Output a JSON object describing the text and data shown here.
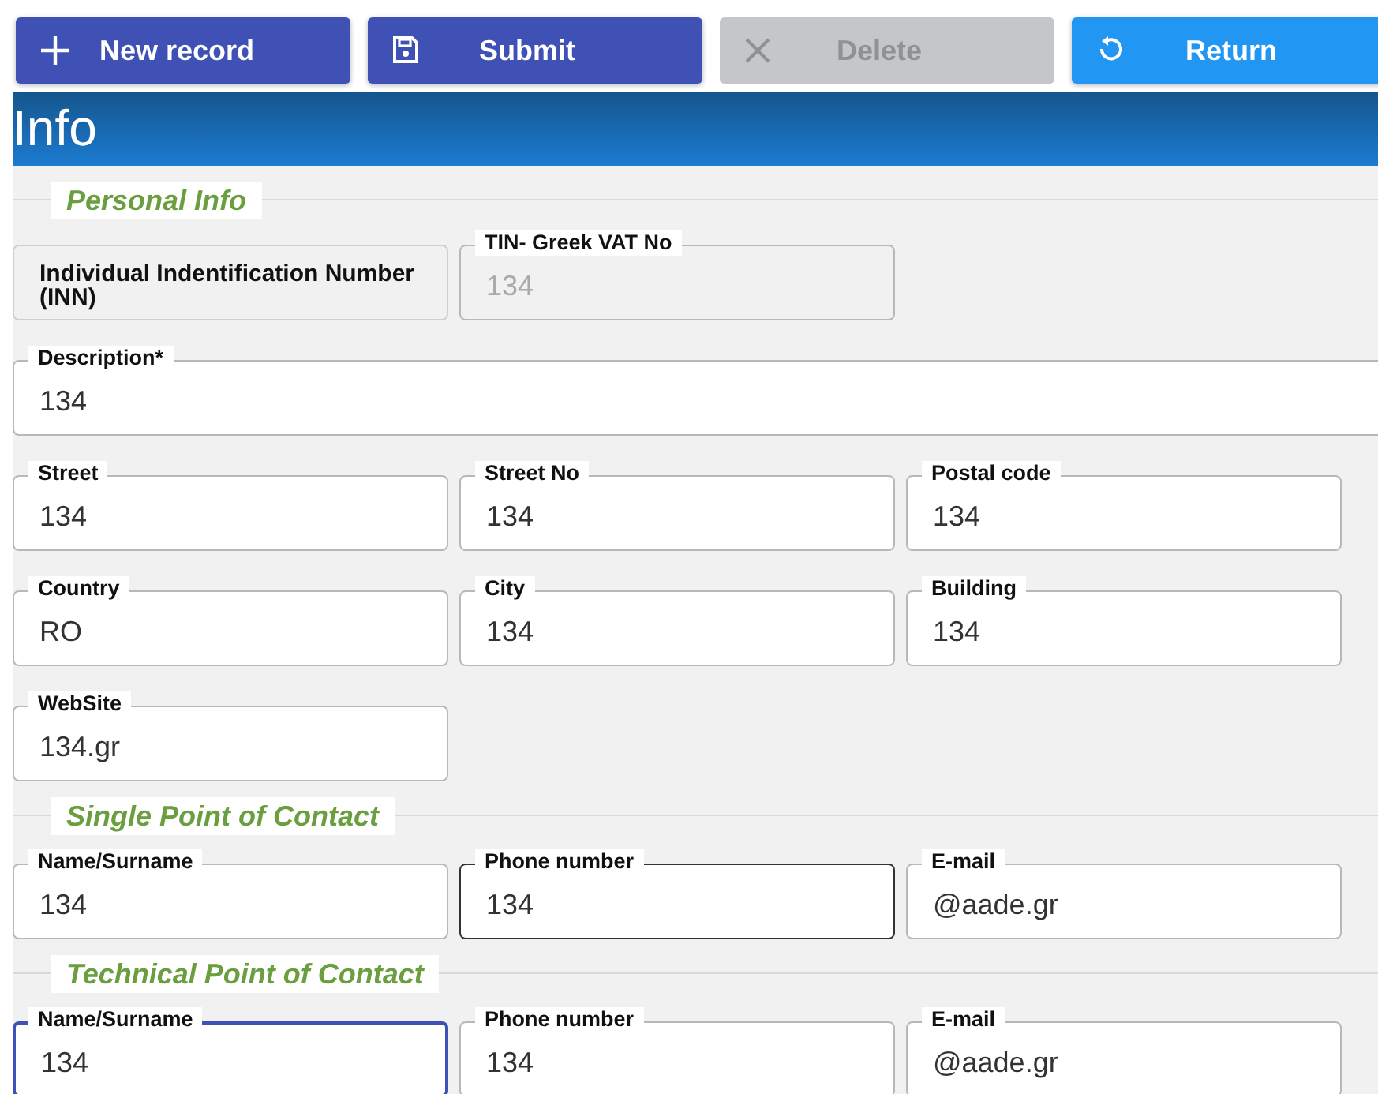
{
  "toolbar": [
    {
      "label": "New record",
      "disabled": false
    },
    {
      "label": "Submit",
      "disabled": false
    },
    {
      "label": "Delete",
      "disabled": true
    },
    {
      "label": "Return",
      "disabled": false
    }
  ],
  "header": {
    "title": "Info"
  },
  "sections": [
    {
      "title": "Personal Info",
      "rows": [
        [
          {
            "kind": "static",
            "label": "Individual Indentification Number (INN)"
          },
          {
            "kind": "field",
            "label": "TIN- Greek VAT No",
            "value": "134",
            "disabled": true,
            "hovered": false,
            "focused": false
          }
        ],
        [
          {
            "kind": "long-field",
            "label": "Description*",
            "value": "134",
            "disabled": false,
            "hovered": false,
            "focused": false
          }
        ],
        [
          {
            "kind": "field",
            "label": "Street",
            "value": "134",
            "disabled": false,
            "hovered": false,
            "focused": false
          },
          {
            "kind": "field",
            "label": "Street No",
            "value": "134",
            "disabled": false,
            "hovered": false,
            "focused": false
          },
          {
            "kind": "field",
            "label": "Postal code",
            "value": "134",
            "disabled": false,
            "hovered": false,
            "focused": false
          }
        ],
        [
          {
            "kind": "field",
            "label": "Country",
            "value": "RO",
            "disabled": false,
            "hovered": false,
            "focused": false
          },
          {
            "kind": "field",
            "label": "City",
            "value": "134",
            "disabled": false,
            "hovered": false,
            "focused": false
          },
          {
            "kind": "field",
            "label": "Building",
            "value": "134",
            "disabled": false,
            "hovered": false,
            "focused": false
          }
        ],
        [
          {
            "kind": "field",
            "label": "WebSite",
            "value": "134.gr",
            "disabled": false,
            "hovered": false,
            "focused": false
          }
        ]
      ]
    },
    {
      "title": "Single Point of Contact",
      "rows": [
        [
          {
            "kind": "field",
            "label": "Name/Surname",
            "value": "134",
            "disabled": false,
            "hovered": false,
            "focused": false
          },
          {
            "kind": "field",
            "label": "Phone number",
            "value": "134",
            "disabled": false,
            "hovered": true,
            "focused": false
          },
          {
            "kind": "field",
            "label": "E-mail",
            "value": "@aade.gr",
            "disabled": false,
            "hovered": false,
            "focused": false
          }
        ]
      ]
    },
    {
      "title": "Technical Point of Contact",
      "rows": [
        [
          {
            "kind": "field",
            "label": "Name/Surname",
            "value": "134",
            "disabled": false,
            "hovered": false,
            "focused": true
          },
          {
            "kind": "field",
            "label": "Phone number",
            "value": "134",
            "disabled": false,
            "hovered": false,
            "focused": false
          },
          {
            "kind": "field",
            "label": "E-mail",
            "value": "@aade.gr",
            "disabled": false,
            "hovered": false,
            "focused": false
          }
        ]
      ]
    }
  ]
}
